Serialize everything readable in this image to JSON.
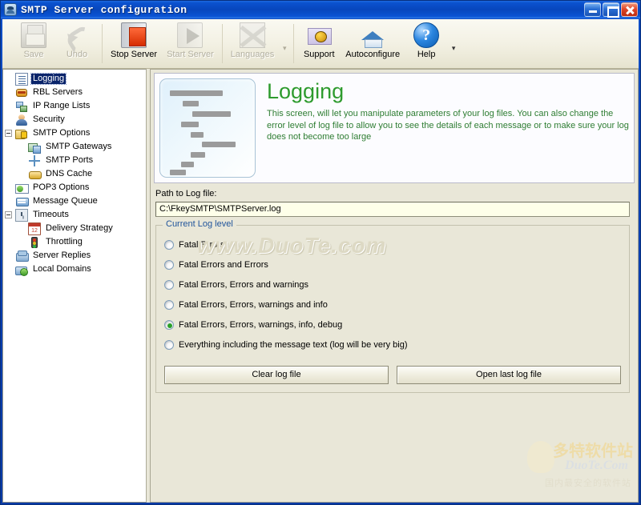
{
  "window": {
    "title": "SMTP Server configuration",
    "icon": "app-shield-icon",
    "controls": {
      "minimize": "Minimize",
      "maximize": "Maximize",
      "close": "Close"
    }
  },
  "toolbar": {
    "items": [
      {
        "label": "Save",
        "icon": "floppy-disk-icon",
        "disabled": true
      },
      {
        "label": "Undo",
        "icon": "undo-arrow-icon",
        "disabled": true
      },
      {
        "label": "Stop Server",
        "icon": "stop-server-icon",
        "disabled": false
      },
      {
        "label": "Start Server",
        "icon": "start-server-icon",
        "disabled": true
      },
      {
        "label": "Languages",
        "icon": "languages-flag-icon",
        "disabled": true
      },
      {
        "label": "Support",
        "icon": "support-mail-icon",
        "disabled": false
      },
      {
        "label": "Autoconfigure",
        "icon": "house-icon",
        "disabled": false
      },
      {
        "label": "Help",
        "icon": "help-question-icon",
        "disabled": false
      }
    ],
    "languages_dropdown": "▾",
    "overflow_dropdown": "▾"
  },
  "sidebar": {
    "items": [
      {
        "label": "Logging",
        "icon": "log-document-icon",
        "level": 0,
        "expander": "none",
        "selected": true
      },
      {
        "label": "RBL Servers",
        "icon": "rbl-database-icon",
        "level": 0,
        "expander": "none",
        "selected": false
      },
      {
        "label": "IP Range Lists",
        "icon": "ip-range-icon",
        "level": 0,
        "expander": "none",
        "selected": false
      },
      {
        "label": "Security",
        "icon": "security-guard-icon",
        "level": 0,
        "expander": "none",
        "selected": false
      },
      {
        "label": "SMTP Options",
        "icon": "smtp-options-icon",
        "level": 0,
        "expander": "minus",
        "selected": false
      },
      {
        "label": "SMTP Gateways",
        "icon": "gateway-icon",
        "level": 1,
        "expander": "none",
        "selected": false
      },
      {
        "label": "SMTP Ports",
        "icon": "ports-icon",
        "level": 1,
        "expander": "none",
        "selected": false
      },
      {
        "label": "DNS Cache",
        "icon": "dns-cache-icon",
        "level": 1,
        "expander": "none",
        "selected": false
      },
      {
        "label": "POP3 Options",
        "icon": "pop3-icon",
        "level": 0,
        "expander": "none",
        "selected": false
      },
      {
        "label": "Message Queue",
        "icon": "message-queue-icon",
        "level": 0,
        "expander": "none",
        "selected": false
      },
      {
        "label": "Timeouts",
        "icon": "timeouts-clock-icon",
        "level": 0,
        "expander": "minus",
        "selected": false
      },
      {
        "label": "Delivery Strategy",
        "icon": "calendar-icon",
        "level": 1,
        "expander": "none",
        "selected": false
      },
      {
        "label": "Throttling",
        "icon": "traffic-light-icon",
        "level": 1,
        "expander": "none",
        "selected": false
      },
      {
        "label": "Server Replies",
        "icon": "server-replies-icon",
        "level": 0,
        "expander": "none",
        "selected": false
      },
      {
        "label": "Local Domains",
        "icon": "local-domains-icon",
        "level": 0,
        "expander": "none",
        "selected": false
      }
    ]
  },
  "header": {
    "title": "Logging",
    "description": "This screen, will let you manipulate parameters of your log files. You can also change the error level of log file to allow you to see the details of each message or to make sure your log does not become too large",
    "illustration": "log-file-preview-icon",
    "title_color": "#2e9b2e",
    "description_color": "#2e7d32"
  },
  "form": {
    "path_label": "Path to Log file:",
    "path_value": "C:\\FkeySMTP\\SMTPServer.log",
    "path_placeholder": "Path to Log file",
    "group_title": "Current Log level",
    "group_title_color": "#21559b",
    "log_levels": [
      {
        "label": "Fatal Errors",
        "selected": false
      },
      {
        "label": "Fatal Errors and Errors",
        "selected": false
      },
      {
        "label": "Fatal Errors, Errors and warnings",
        "selected": false
      },
      {
        "label": "Fatal Errors, Errors, warnings and  info",
        "selected": false
      },
      {
        "label": "Fatal Errors, Errors, warnings, info, debug",
        "selected": true
      },
      {
        "label": "Everything including the message text (log will be very big)",
        "selected": false
      }
    ],
    "buttons": {
      "clear": "Clear log file",
      "open": "Open last log file"
    }
  },
  "watermarks": {
    "center": "www.DuoTe.com",
    "corner_cn": "多特软件站",
    "corner_domain": "DuoTe.Com",
    "corner_tagline": "国内最安全的软件站"
  }
}
